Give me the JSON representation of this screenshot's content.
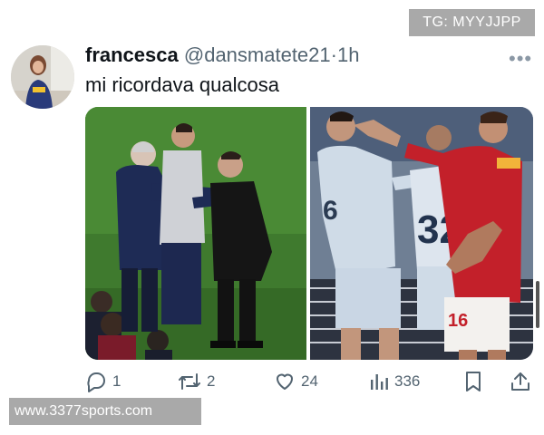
{
  "watermarks": {
    "top": "TG: MYYJJPP",
    "bottom": "www.3377sports.com"
  },
  "tweet": {
    "author_name": "francesca",
    "handle": "@dansmatete21",
    "separator": "·",
    "time": "1h",
    "text": "mi ricordava qualcosa"
  },
  "media": {
    "left_photo": {
      "shirt_number": ""
    },
    "right_photo": {
      "shirt_numbers": [
        "6",
        "32",
        "16"
      ]
    }
  },
  "actions": {
    "reply": {
      "icon": "reply-icon",
      "count": "1"
    },
    "repost": {
      "icon": "repost-icon",
      "count": "2"
    },
    "like": {
      "icon": "heart-icon",
      "count": "24"
    },
    "views": {
      "icon": "views-icon",
      "count": "336"
    },
    "bookmark": {
      "icon": "bookmark-icon"
    },
    "share": {
      "icon": "share-icon"
    }
  },
  "colors": {
    "text": "#0f1419",
    "secondary": "#536471",
    "background": "#ffffff"
  }
}
